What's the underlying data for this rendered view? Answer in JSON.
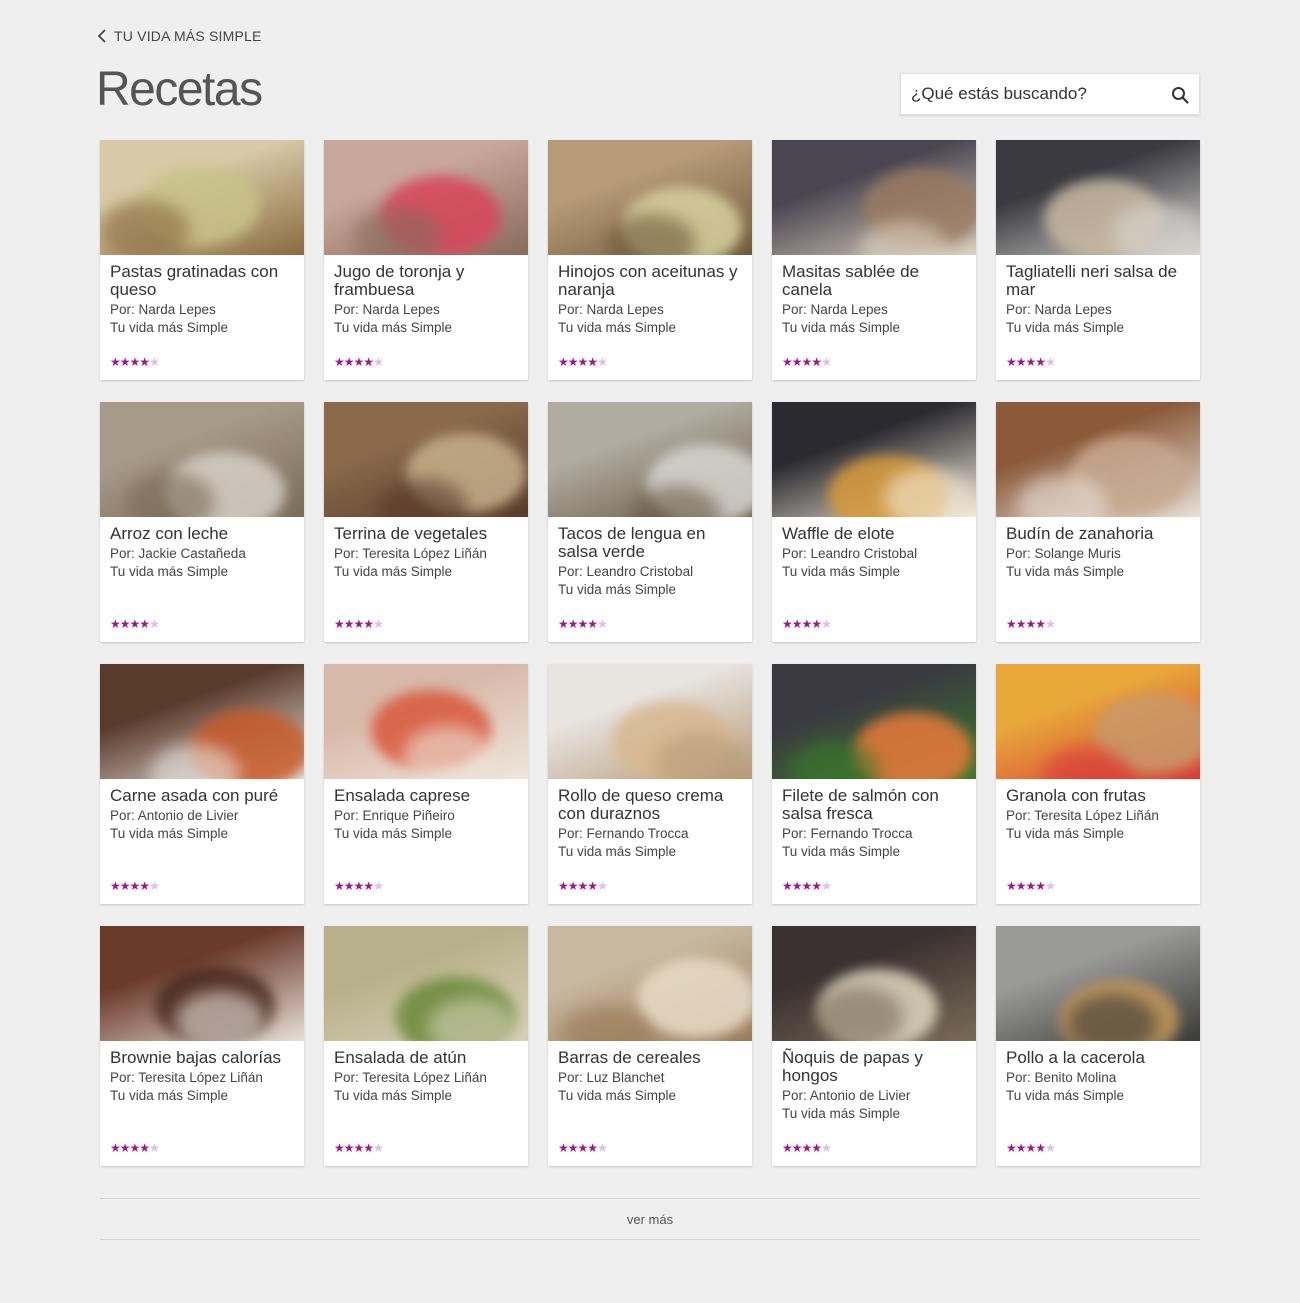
{
  "nav": {
    "back_label": "TU VIDA MÁS SIMPLE"
  },
  "page": {
    "title": "Recetas"
  },
  "search": {
    "placeholder": "¿Qué estás buscando?"
  },
  "colors": {
    "accent": "#a0168c",
    "star_off": "#e2bde0",
    "background": "#efefef"
  },
  "recipes": [
    {
      "title": "Pastas gratinadas con queso",
      "author": "Por: Narda Lepes",
      "show": "Tu vida más Simple",
      "rating": 4,
      "thumb": [
        "#d8c9a8",
        "#c9c38a",
        "#8b6a3e"
      ]
    },
    {
      "title": "Jugo de toronja y frambuesa",
      "author": "Por: Narda Lepes",
      "show": "Tu vida más Simple",
      "rating": 4,
      "thumb": [
        "#c9a79a",
        "#d9455a",
        "#8a6a5a"
      ]
    },
    {
      "title": "Hinojos con aceitunas y naranja",
      "author": "Por: Narda Lepes",
      "show": "Tu vida más Simple",
      "rating": 4,
      "thumb": [
        "#b89a78",
        "#d8d1a0",
        "#6e5a3a"
      ]
    },
    {
      "title": "Masitas sablée de canela",
      "author": "Por: Narda Lepes",
      "show": "Tu vida más Simple",
      "rating": 4,
      "thumb": [
        "#4a4550",
        "#9a7a62",
        "#ddd2c0"
      ]
    },
    {
      "title": "Tagliatelli neri salsa de mar",
      "author": "Por: Narda Lepes",
      "show": "Tu vida más Simple",
      "rating": 4,
      "thumb": [
        "#3a3a40",
        "#c8b8a0",
        "#d8d6d0"
      ]
    },
    {
      "title": "Arroz con leche",
      "author": "Por: Jackie Castañeda",
      "show": "Tu vida más Simple",
      "rating": 4,
      "thumb": [
        "#a89a88",
        "#d6d0c6",
        "#7a6a58"
      ]
    },
    {
      "title": "Terrina de vegetales",
      "author": "Por: Teresita López Liñán",
      "show": "Tu vida más Simple",
      "rating": 4,
      "thumb": [
        "#8a6a4a",
        "#c7b08c",
        "#5a3a2a"
      ]
    },
    {
      "title": "Tacos de lengua en salsa verde",
      "author": "Por: Leandro Cristobal",
      "show": "Tu vida más Simple",
      "rating": 4,
      "thumb": [
        "#b0aca0",
        "#d8d6d0",
        "#6a5a48"
      ]
    },
    {
      "title": "Waffle de elote",
      "author": "Por: Leandro Cristobal",
      "show": "Tu vida más Simple",
      "rating": 4,
      "thumb": [
        "#2a2a30",
        "#d89a3a",
        "#f4ead8"
      ]
    },
    {
      "title": "Budín de zanahoria",
      "author": "Por: Solange Muris",
      "show": "Tu vida más Simple",
      "rating": 4,
      "thumb": [
        "#8a5a3a",
        "#c8a890",
        "#e8e0d8"
      ]
    },
    {
      "title": "Carne asada con puré",
      "author": "Por: Antonio de Livier",
      "show": "Tu vida más Simple",
      "rating": 4,
      "thumb": [
        "#5a3a2a",
        "#c85a2a",
        "#e8e4e0"
      ]
    },
    {
      "title": "Ensalada caprese",
      "author": "Por:  Enrique Piñeiro",
      "show": "Tu vida más Simple",
      "rating": 4,
      "thumb": [
        "#d8b8a8",
        "#d8583a",
        "#efe6dc"
      ]
    },
    {
      "title": "Rollo de queso crema con duraznos",
      "author": "Por: Fernando Trocca",
      "show": "Tu vida más Simple",
      "rating": 4,
      "thumb": [
        "#e8e4e0",
        "#d8b890",
        "#b89a78"
      ]
    },
    {
      "title": "Filete de salmón con salsa fresca",
      "author": "Por: Fernando Trocca",
      "show": "Tu vida más Simple",
      "rating": 4,
      "thumb": [
        "#3a3a40",
        "#e87a3a",
        "#3a7a2a"
      ]
    },
    {
      "title": "Granola con frutas",
      "author": "Por: Teresita López Liñán",
      "show": "Tu vida más Simple",
      "rating": 4,
      "thumb": [
        "#e8a83a",
        "#c89a6a",
        "#d83a3a"
      ]
    },
    {
      "title": "Brownie bajas calorías",
      "author": "Por: Teresita López Liñán",
      "show": "Tu vida más Simple",
      "rating": 4,
      "thumb": [
        "#6a3a2a",
        "#4a2a20",
        "#e8e0d8"
      ]
    },
    {
      "title": "Ensalada de atún",
      "author": "Por:  Teresita López Liñán",
      "show": "Tu vida más Simple",
      "rating": 4,
      "thumb": [
        "#b8b08a",
        "#6a8a3a",
        "#d8d0b8"
      ]
    },
    {
      "title": "Barras de cereales",
      "author": "Por: Luz Blanchet",
      "show": "Tu vida más Simple",
      "rating": 4,
      "thumb": [
        "#c8b8a0",
        "#e8dcc8",
        "#9a7a58"
      ]
    },
    {
      "title": "Ñoquis de papas y hongos",
      "author": "Por: Antonio de Livier",
      "show": "Tu vida más Simple",
      "rating": 4,
      "thumb": [
        "#3a3230",
        "#e0d8c0",
        "#7a6a58"
      ]
    },
    {
      "title": "Pollo a la cacerola",
      "author": "Por: Benito Molina",
      "show": "Tu vida más Simple",
      "rating": 4,
      "thumb": [
        "#9a9a98",
        "#c89a5a",
        "#3a3a38"
      ]
    }
  ],
  "footer": {
    "more_label": "ver más"
  }
}
